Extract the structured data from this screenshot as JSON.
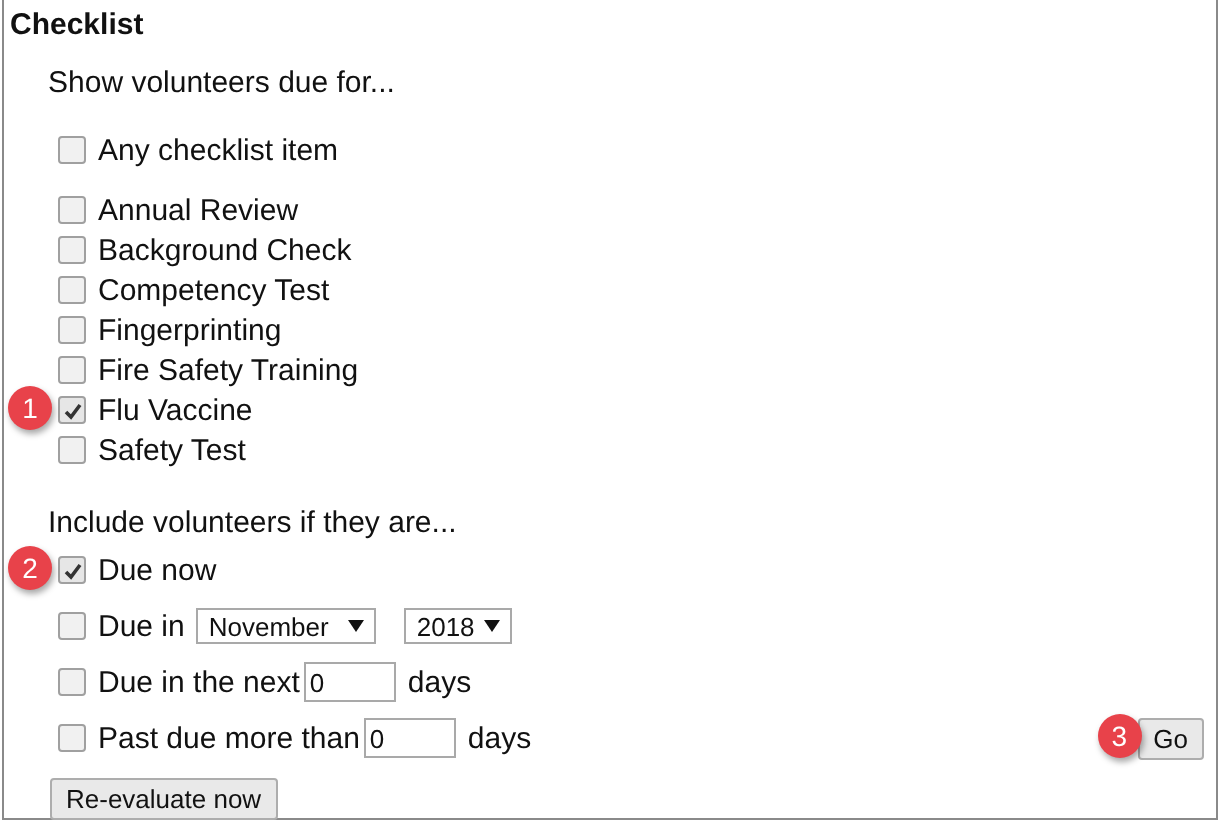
{
  "title": "Checklist",
  "intro": "Show volunteers due for...",
  "any_item": {
    "label": "Any checklist item",
    "checked": false
  },
  "items": [
    {
      "label": "Annual Review",
      "checked": false
    },
    {
      "label": "Background Check",
      "checked": false
    },
    {
      "label": "Competency Test",
      "checked": false
    },
    {
      "label": "Fingerprinting",
      "checked": false
    },
    {
      "label": "Fire Safety Training",
      "checked": false
    },
    {
      "label": "Flu Vaccine",
      "checked": true,
      "callout": "1"
    },
    {
      "label": "Safety Test",
      "checked": false
    }
  ],
  "include_label": "Include volunteers if they are...",
  "conditions": [
    {
      "kind": "plain",
      "label": "Due now",
      "checked": true,
      "callout": "2"
    },
    {
      "kind": "month_year",
      "label": "Due in",
      "checked": false,
      "month": "November",
      "year": "2018"
    },
    {
      "kind": "days",
      "label": "Due in the next",
      "checked": false,
      "value": "0",
      "unit": "days"
    },
    {
      "kind": "days",
      "label": "Past due more than",
      "checked": false,
      "value": "0",
      "unit": "days"
    }
  ],
  "go_button": {
    "label": "Go",
    "callout": "3"
  },
  "reevaluate_button": {
    "label": "Re-evaluate now"
  }
}
